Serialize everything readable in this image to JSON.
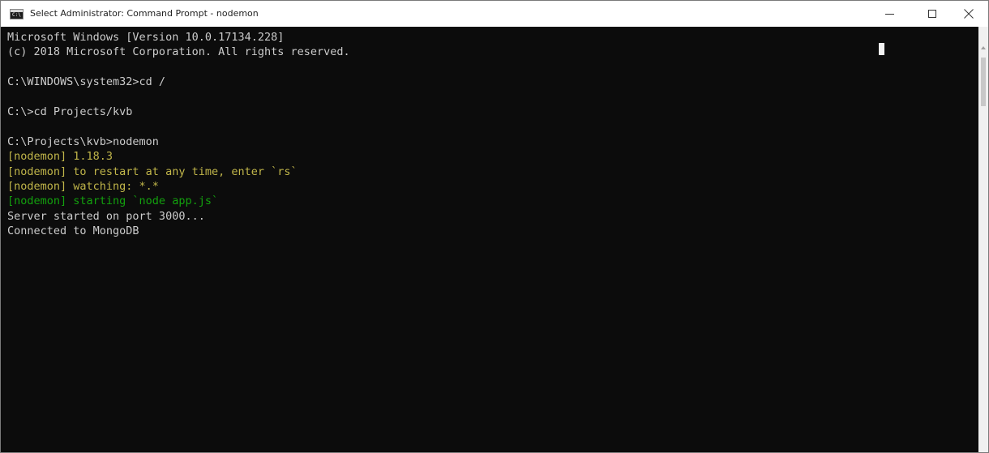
{
  "window": {
    "title": "Select Administrator: Command Prompt - nodemon",
    "icon": "cmd-icon",
    "icon_prompt": "C:\\"
  },
  "controls": {
    "minimize_icon": "minimize-icon",
    "maximize_icon": "maximize-icon",
    "close_icon": "close-icon"
  },
  "colors": {
    "console_bg": "#0c0c0c",
    "default_text": "#cccccc",
    "nodemon_yellow": "#c1b64a",
    "nodemon_green": "#13a10e"
  },
  "console": {
    "lines": [
      {
        "text": "Microsoft Windows [Version 10.0.17134.228]",
        "color": "default"
      },
      {
        "text": "(c) 2018 Microsoft Corporation. All rights reserved.",
        "color": "default"
      },
      {
        "text": "",
        "color": "default"
      },
      {
        "text": "C:\\WINDOWS\\system32>cd /",
        "color": "default"
      },
      {
        "text": "",
        "color": "default"
      },
      {
        "text": "C:\\>cd Projects/kvb",
        "color": "default"
      },
      {
        "text": "",
        "color": "default"
      },
      {
        "text": "C:\\Projects\\kvb>nodemon",
        "color": "default"
      },
      {
        "text": "[nodemon] 1.18.3",
        "color": "yellow"
      },
      {
        "text": "[nodemon] to restart at any time, enter `rs`",
        "color": "yellow"
      },
      {
        "text": "[nodemon] watching: *.*",
        "color": "yellow"
      },
      {
        "text": "[nodemon] starting `node app.js`",
        "color": "green"
      },
      {
        "text": "Server started on port 3000...",
        "color": "default"
      },
      {
        "text": "Connected to MongoDB",
        "color": "default"
      }
    ]
  }
}
